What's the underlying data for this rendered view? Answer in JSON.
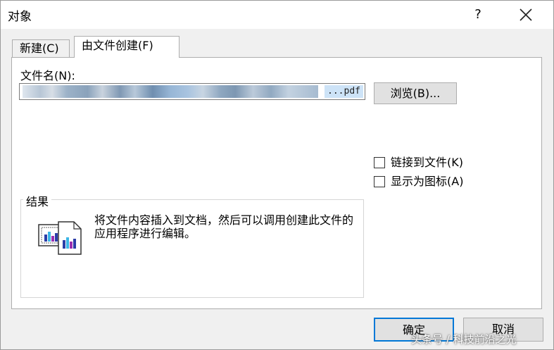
{
  "window": {
    "title": "对象",
    "help_label": "?"
  },
  "tabs": [
    {
      "label": "新建(C)"
    },
    {
      "label": "由文件创建(F)"
    }
  ],
  "form": {
    "filename_label": "文件名(N):",
    "filename_value_tail": "...pdf",
    "browse_label": "浏览(B)..."
  },
  "options": {
    "link_label": "链接到文件(K)",
    "link_checked": false,
    "icon_label": "显示为图标(A)",
    "icon_checked": false
  },
  "result": {
    "title": "结果",
    "description": "将文件内容插入到文档，然后可以调用创建此文件的应用程序进行编辑。"
  },
  "footer": {
    "ok_label": "确定",
    "cancel_label": "取消"
  },
  "watermark": "头条号 / 科技前沿之光",
  "colors": {
    "accent": "#0078d7",
    "dialog_bg": "#f0f0f0",
    "selection": "#cde3f7"
  }
}
